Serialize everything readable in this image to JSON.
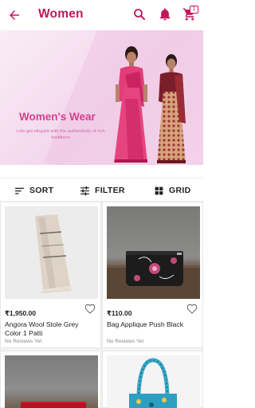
{
  "header": {
    "title": "Women",
    "cart_count": "1",
    "icons": [
      "back-arrow-icon",
      "search-icon",
      "bell-icon",
      "cart-icon"
    ]
  },
  "banner": {
    "heading": "Women's Wear",
    "subtext": "Lets get elegant with the authenticity of rich traditions"
  },
  "toolbar": {
    "sort_label": "SORT",
    "filter_label": "FILTER",
    "grid_label": "GRID"
  },
  "products": [
    {
      "price": "₹1,950.00",
      "name": "Angora Wool Stole Grey Color 1 Patti",
      "reviews": "No Reviews Yet"
    },
    {
      "price": "₹110.00",
      "name": "Bag Applique Push Black",
      "reviews": "No Reviews Yet"
    },
    {
      "price": "",
      "name": "",
      "reviews": ""
    },
    {
      "price": "",
      "name": "",
      "reviews": ""
    }
  ],
  "colors": {
    "accent": "#c2185b",
    "banner_text": "#d43f8d",
    "banner_bg": "#f7e3f1"
  }
}
